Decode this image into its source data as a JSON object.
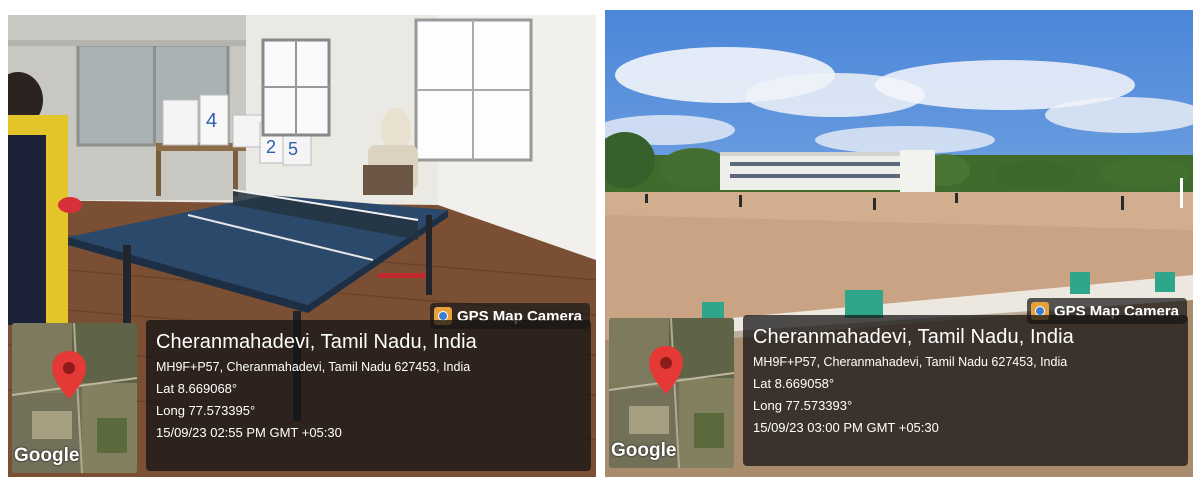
{
  "photos": [
    {
      "camera_label": "GPS Map Camera",
      "map_brand": "Google",
      "place": "Cheranmahadevi, Tamil Nadu, India",
      "address": "MH9F+P57, Cheranmahadevi, Tamil Nadu 627453, India",
      "lat": "Lat 8.669068°",
      "long": "Long 77.573395°",
      "datetime": "15/09/23 02:55 PM GMT +05:30",
      "table_digits": [
        "4",
        "2",
        "5"
      ]
    },
    {
      "camera_label": "GPS Map Camera",
      "map_brand": "Google",
      "place": "Cheranmahadevi, Tamil Nadu, India",
      "address": "MH9F+P57, Cheranmahadevi, Tamil Nadu 627453, India",
      "lat": "Lat 8.669058°",
      "long": "Long 77.573393°",
      "datetime": "15/09/23 03:00 PM GMT +05:30"
    }
  ],
  "colors": {
    "pin_red": "#e53935",
    "overlay": "#141414",
    "badge_orange": "#e8a23b"
  }
}
